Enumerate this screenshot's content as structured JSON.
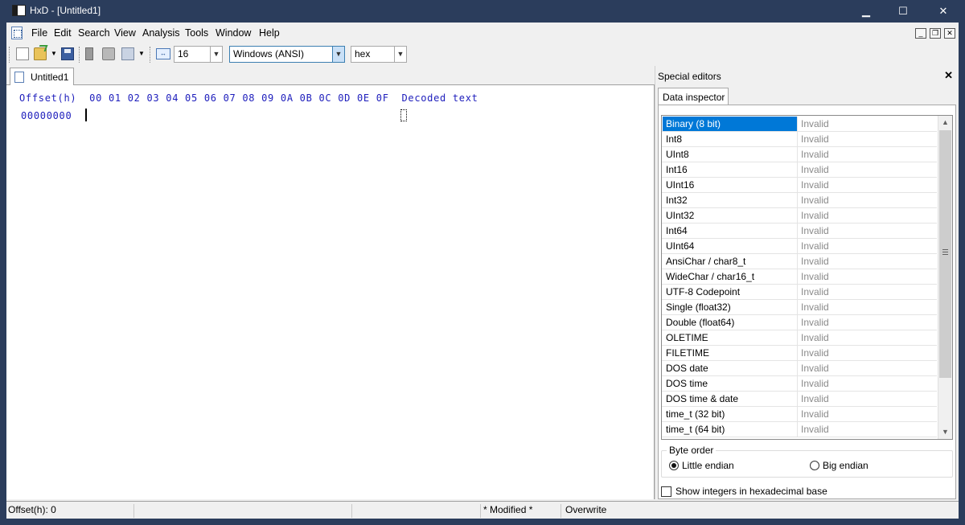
{
  "window": {
    "title": "HxD - [Untitled1]",
    "icon": "hxd-app-icon",
    "controls": {
      "minimize": "▁",
      "maximize": "☐",
      "close": "✕"
    }
  },
  "menubar": {
    "items": [
      "File",
      "Edit",
      "Search",
      "View",
      "Analysis",
      "Tools",
      "Window",
      "Help"
    ],
    "mdi_controls": {
      "minimize": "_",
      "restore": "❐",
      "close": "✕"
    }
  },
  "toolbar": {
    "bytes_per_row": "16",
    "charset": "Windows (ANSI)",
    "offset_base": "hex"
  },
  "document": {
    "tab_label": "Untitled1",
    "header": "Offset(h)  00 01 02 03 04 05 06 07 08 09 0A 0B 0C 0D 0E 0F  Decoded text",
    "first_offset": "00000000"
  },
  "special_editors": {
    "title": "Special editors",
    "close": "✕",
    "tab_label": "Data inspector",
    "selected_row": 0,
    "rows": [
      {
        "name": "Binary (8 bit)",
        "value": "Invalid"
      },
      {
        "name": "Int8",
        "value": "Invalid"
      },
      {
        "name": "UInt8",
        "value": "Invalid"
      },
      {
        "name": "Int16",
        "value": "Invalid"
      },
      {
        "name": "UInt16",
        "value": "Invalid"
      },
      {
        "name": "Int32",
        "value": "Invalid"
      },
      {
        "name": "UInt32",
        "value": "Invalid"
      },
      {
        "name": "Int64",
        "value": "Invalid"
      },
      {
        "name": "UInt64",
        "value": "Invalid"
      },
      {
        "name": "AnsiChar / char8_t",
        "value": "Invalid"
      },
      {
        "name": "WideChar / char16_t",
        "value": "Invalid"
      },
      {
        "name": "UTF-8 Codepoint",
        "value": "Invalid"
      },
      {
        "name": "Single (float32)",
        "value": "Invalid"
      },
      {
        "name": "Double (float64)",
        "value": "Invalid"
      },
      {
        "name": "OLETIME",
        "value": "Invalid"
      },
      {
        "name": "FILETIME",
        "value": "Invalid"
      },
      {
        "name": "DOS date",
        "value": "Invalid"
      },
      {
        "name": "DOS time",
        "value": "Invalid"
      },
      {
        "name": "DOS time & date",
        "value": "Invalid"
      },
      {
        "name": "time_t (32 bit)",
        "value": "Invalid"
      },
      {
        "name": "time_t (64 bit)",
        "value": "Invalid"
      }
    ],
    "byte_order": {
      "legend": "Byte order",
      "little": "Little endian",
      "big": "Big endian",
      "selected": "little"
    },
    "hex_base_checkbox": {
      "label": "Show integers in hexadecimal base",
      "checked": false
    }
  },
  "statusbar": {
    "offset": "Offset(h): 0",
    "cell2": "",
    "cell3": "",
    "modified": "* Modified *",
    "mode": "Overwrite"
  },
  "colors": {
    "title_bar": "#2b3d5c",
    "hex_text": "#1d1dbc",
    "selection": "#0078d7",
    "invalid_text": "#8a8a8a"
  }
}
